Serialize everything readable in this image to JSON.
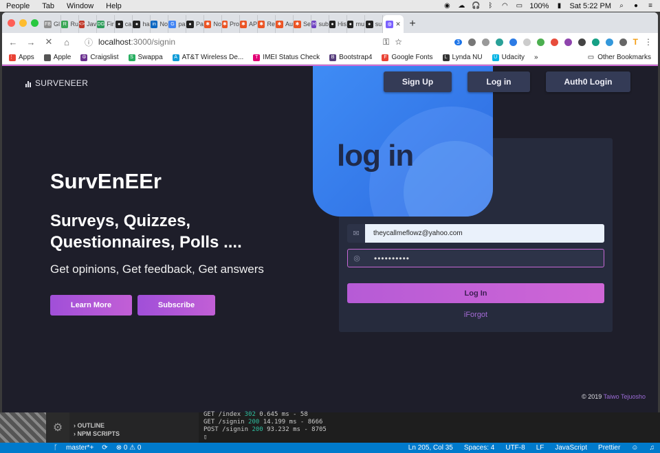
{
  "macos_menu": {
    "items": [
      "People",
      "Tab",
      "Window",
      "Help"
    ],
    "battery": "100%",
    "clock": "Sat 5:22 PM"
  },
  "browser": {
    "tabs": [
      {
        "fav": "FB",
        "label": "Gl",
        "color": "#8e8e8e"
      },
      {
        "fav": "R",
        "label": "Ru",
        "color": "#3aa757"
      },
      {
        "fav": "<>",
        "label": "Jav",
        "color": "#c0392b"
      },
      {
        "fav": "DG",
        "label": "Fir",
        "color": "#2d9c5a"
      },
      {
        "fav": "●",
        "label": "ca",
        "color": "#222222"
      },
      {
        "fav": "●",
        "label": "ha",
        "color": "#222222"
      },
      {
        "fav": "in",
        "label": "No",
        "color": "#0a66c2"
      },
      {
        "fav": "G",
        "label": "pa",
        "color": "#4285f4"
      },
      {
        "fav": "●",
        "label": "Pa",
        "color": "#222222"
      },
      {
        "fav": "✱",
        "label": "No",
        "color": "#eb5424"
      },
      {
        "fav": "✱",
        "label": "Pro",
        "color": "#eb5424"
      },
      {
        "fav": "✱",
        "label": "AP",
        "color": "#eb5424"
      },
      {
        "fav": "✱",
        "label": "Re",
        "color": "#eb5424"
      },
      {
        "fav": "✱",
        "label": "Au",
        "color": "#eb5424"
      },
      {
        "fav": "✱",
        "label": "Se",
        "color": "#eb5424"
      },
      {
        "fav": "H",
        "label": "sub",
        "color": "#6f42c1"
      },
      {
        "fav": "●",
        "label": "His",
        "color": "#222222"
      },
      {
        "fav": "●",
        "label": "mu",
        "color": "#222222"
      },
      {
        "fav": "●",
        "label": "su",
        "color": "#222222"
      }
    ],
    "active_tab_close": "✕",
    "new_tab": "+",
    "url_host": "localhost",
    "url_path": ":3000/signin",
    "ext_badge": "3",
    "bookmarks": [
      {
        "label": "Apps",
        "icon": "⋮⋮",
        "color": "#e94235"
      },
      {
        "label": "Apple",
        "icon": "",
        "color": "#555555"
      },
      {
        "label": "Craigslist",
        "icon": "☮",
        "color": "#6a2f8f"
      },
      {
        "label": "Swappa",
        "icon": "S",
        "color": "#27ae60"
      },
      {
        "label": "AT&T Wireless De...",
        "icon": "A",
        "color": "#0f9bd7"
      },
      {
        "label": "IMEI Status Check",
        "icon": "T",
        "color": "#e20074"
      },
      {
        "label": "Bootstrap4",
        "icon": "B",
        "color": "#563d7c"
      },
      {
        "label": "Google Fonts",
        "icon": "F",
        "color": "#ea4335"
      },
      {
        "label": "Lynda NU",
        "icon": "L",
        "color": "#333333"
      },
      {
        "label": "Udacity",
        "icon": "U",
        "color": "#02b3e4"
      }
    ],
    "more_bookmarks": "»",
    "other_bookmarks": "Other Bookmarks"
  },
  "site": {
    "brand": "SURVENEER",
    "nav": {
      "signup": "Sign Up",
      "login": "Log in",
      "auth0": "Auth0 Login"
    },
    "hero": {
      "title": "SurvEnEEr",
      "subtitle": "Surveys, Quizzes, Questionnaires, Polls ....",
      "tagline": "Get opinions, Get feedback, Get answers",
      "learn_more": "Learn More",
      "subscribe": "Subscribe"
    },
    "login": {
      "heading": "log in",
      "email_value": "theycallmeflowz@yahoo.com",
      "password_value": "••••••••••",
      "submit": "Log In",
      "forgot": "iForgot"
    },
    "footer": {
      "copyright": "© 2019 ",
      "author": "Taiwo Tejuosho"
    }
  },
  "editor": {
    "outline": "OUTLINE",
    "npm_scripts": "NPM SCRIPTS",
    "terminal": [
      {
        "method": "GET /index ",
        "code": "302",
        "rest": " 0.645 ms - 58"
      },
      {
        "method": "GET /signin ",
        "code": "200",
        "rest": " 14.199 ms - 8666"
      },
      {
        "method": "POST /signin ",
        "code": "200",
        "rest": " 93.232 ms - 8705"
      }
    ],
    "cursor": "▯"
  },
  "statusbar": {
    "branch": "master*+",
    "problems": "⊗ 0 ⚠ 0",
    "position": "Ln 205, Col 35",
    "spaces": "Spaces: 4",
    "encoding": "UTF-8",
    "eol": "LF",
    "language": "JavaScript",
    "formatter": "Prettier"
  }
}
